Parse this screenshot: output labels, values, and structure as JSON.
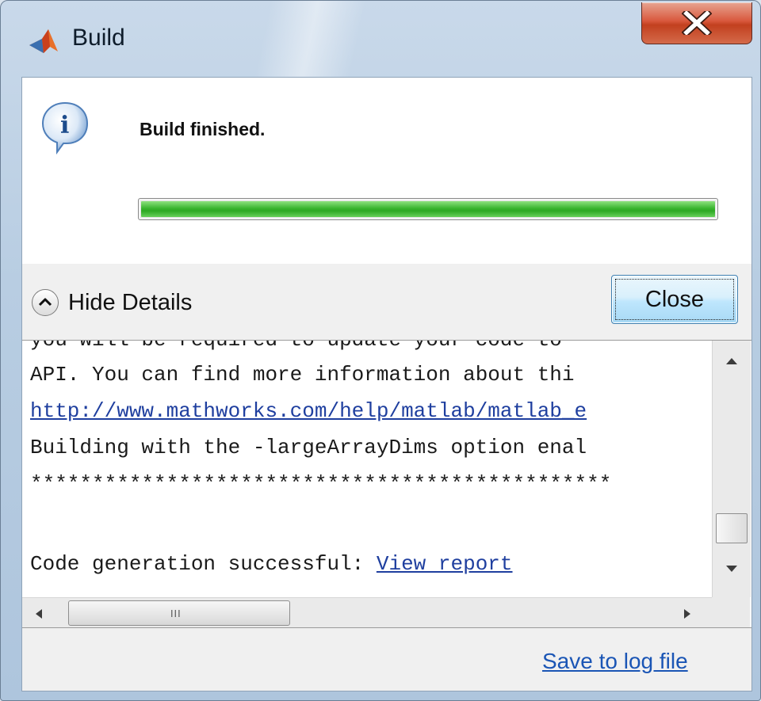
{
  "window": {
    "title": "Build",
    "app_icon": "matlab-logo-icon",
    "close_icon": "close-icon"
  },
  "status": {
    "icon": "info-icon",
    "message": "Build finished.",
    "progress_percent": 100,
    "progress_color": "#3ab530"
  },
  "details": {
    "toggle_icon": "chevron-up-icon",
    "toggle_label": "Hide Details",
    "close_label": "Close"
  },
  "log": {
    "lines": [
      {
        "text": "you will be required to update your code to"
      },
      {
        "text": "API. You can find more information about thi"
      },
      {
        "link": "http://www.mathworks.com/help/matlab/matlab_e"
      },
      {
        "text": "Building with the -largeArrayDims option enal"
      },
      {
        "text": "***********************************************"
      },
      {
        "text": ""
      },
      {
        "text": "Code generation successful: ",
        "link": "View report"
      }
    ],
    "scroll_up_icon": "arrow-up-icon",
    "scroll_down_icon": "arrow-down-icon",
    "scroll_left_icon": "arrow-left-icon",
    "scroll_right_icon": "arrow-right-icon",
    "h_thumb_grip": "III"
  },
  "footer": {
    "save_label": "Save to log file"
  }
}
